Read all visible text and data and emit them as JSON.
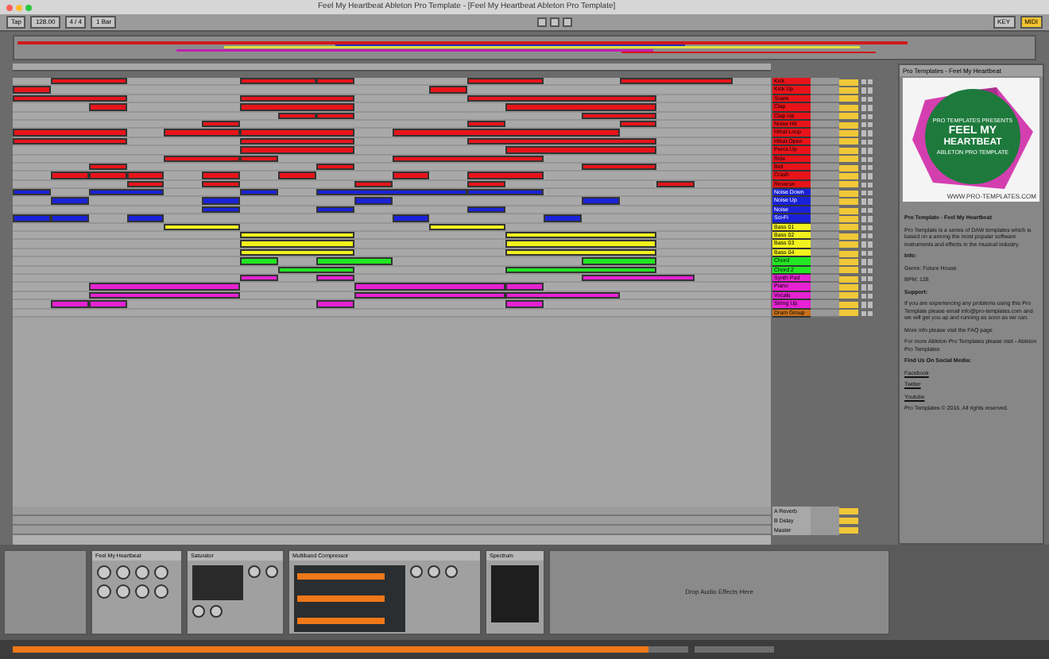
{
  "window": {
    "title": "Feel My Heartbeat Ableton Pro Template - [Feel My Heartbeat Ableton Pro Template]"
  },
  "control_bar": {
    "tap": "Tap",
    "tempo": "128.00",
    "signature": "4 / 4",
    "quantize": "1 Bar",
    "key": "KEY",
    "midi": "MIDI"
  },
  "tracks": [
    {
      "name": "Kick",
      "color": "#e8141a"
    },
    {
      "name": "Kick Up",
      "color": "#e8141a"
    },
    {
      "name": "Snare",
      "color": "#e8141a"
    },
    {
      "name": "Clap",
      "color": "#e8141a"
    },
    {
      "name": "Clap Up",
      "color": "#e8141a"
    },
    {
      "name": "Noise Hit",
      "color": "#e8141a"
    },
    {
      "name": "Hihat Loop",
      "color": "#e8141a"
    },
    {
      "name": "Hihat Open",
      "color": "#e8141a"
    },
    {
      "name": "Percs Up",
      "color": "#e8141a"
    },
    {
      "name": "Ride",
      "color": "#e8141a"
    },
    {
      "name": "Bell",
      "color": "#e8141a"
    },
    {
      "name": "Crash",
      "color": "#e8141a"
    },
    {
      "name": "Reverse",
      "color": "#e8141a"
    },
    {
      "name": "Noise Down",
      "color": "#1a22d8"
    },
    {
      "name": "Noise Up",
      "color": "#1a22d8"
    },
    {
      "name": "Noise",
      "color": "#1a22d8"
    },
    {
      "name": "Sci-Fi",
      "color": "#1a22d8"
    },
    {
      "name": "Bass 01",
      "color": "#f2f21e"
    },
    {
      "name": "Bass 02",
      "color": "#f2f21e"
    },
    {
      "name": "Bass 03",
      "color": "#f2f21e"
    },
    {
      "name": "Bass 04",
      "color": "#f2f21e"
    },
    {
      "name": "Chord",
      "color": "#22e622"
    },
    {
      "name": "Chord 2",
      "color": "#22e622"
    },
    {
      "name": "Synth Pad",
      "color": "#e622d2"
    },
    {
      "name": "Piano",
      "color": "#e622d2"
    },
    {
      "name": "Vocals",
      "color": "#e622d2"
    },
    {
      "name": "String Up",
      "color": "#e622d2"
    },
    {
      "name": "Drum Group",
      "color": "#c8701e"
    }
  ],
  "returns": [
    {
      "name": "A Reverb"
    },
    {
      "name": "B Delay"
    },
    {
      "name": "Master"
    }
  ],
  "info_panel": {
    "header": "Pro Templates - Feel My Heartbeat",
    "artwork": {
      "kicker": "PRO TEMPLATES PRESENTS",
      "title_1": "FEEL MY",
      "title_2": "HEARTBEAT",
      "subtitle": "ABLETON PRO TEMPLATE",
      "site": "WWW.PRO-TEMPLATES.COM"
    },
    "paragraphs": [
      {
        "kind": "heading",
        "text": "Pro Template - Feel My Heartbeat"
      },
      {
        "kind": "text",
        "text": "Pro Template is a series of DAW templates which is based on a among the most popular software instruments and effects in the musical industry."
      },
      {
        "kind": "heading",
        "text": "Info:"
      },
      {
        "kind": "text",
        "text": "Genre: Future House"
      },
      {
        "kind": "text",
        "text": "BPM: 128"
      },
      {
        "kind": "heading",
        "text": "Support:"
      },
      {
        "kind": "text",
        "text": "If you are experiencing any problems using this Pro Template please email info@pro-templates.com and we will get you up and running as soon as we can."
      },
      {
        "kind": "text",
        "text": "More info please visit the FAQ page"
      },
      {
        "kind": "text",
        "text": "For more Ableton Pro Templates please visit - Ableton Pro Templates"
      },
      {
        "kind": "heading",
        "text": "Find Us On Social Media:"
      },
      {
        "kind": "link",
        "text": "Facebook"
      },
      {
        "kind": "link",
        "text": "Twitter"
      },
      {
        "kind": "link",
        "text": "Youtube"
      },
      {
        "kind": "text",
        "text": "Pro Templates © 2016. All rights reserved."
      }
    ]
  },
  "devices": [
    {
      "kind": "rack",
      "title": "Feel My Heartbeat"
    },
    {
      "kind": "saturator",
      "title": "Saturator"
    },
    {
      "kind": "compressor",
      "title": "Multiband Compressor"
    },
    {
      "kind": "scope",
      "title": "Spectrum"
    }
  ],
  "drop_area": {
    "text": "Drop Audio Effects Here"
  },
  "status_bar": {
    "level": 0.94
  }
}
